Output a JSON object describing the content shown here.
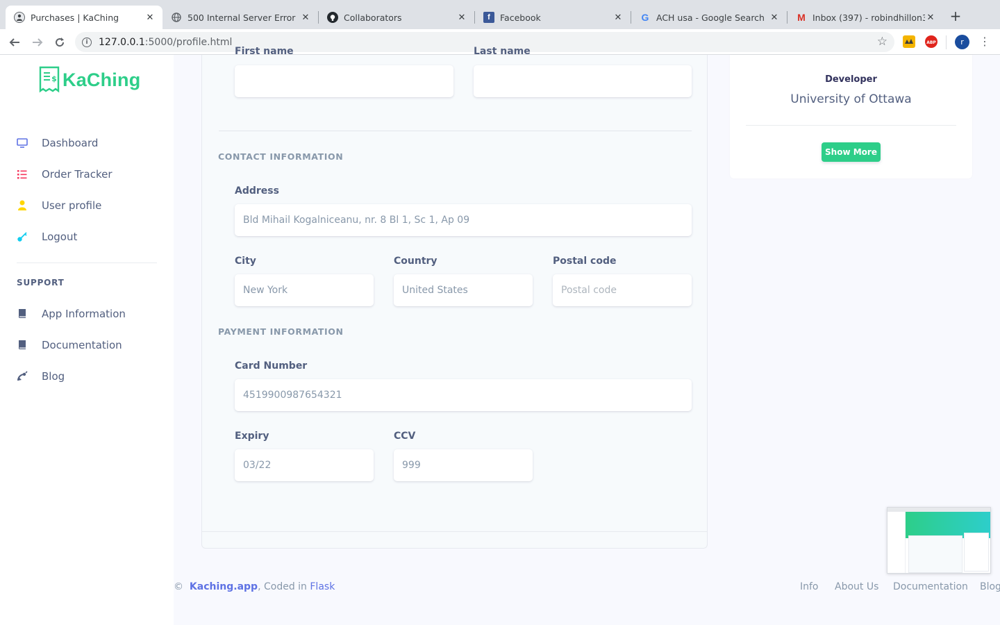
{
  "browser": {
    "tabs": [
      {
        "title": "Purchases | KaChing",
        "favicon": "kaching-avatar-icon",
        "active": true
      },
      {
        "title": "500 Internal Server Error",
        "favicon": "globe-icon",
        "active": false
      },
      {
        "title": "Collaborators",
        "favicon": "github-icon",
        "active": false
      },
      {
        "title": "Facebook",
        "favicon": "facebook-icon",
        "active": false
      },
      {
        "title": "ACH usa - Google Search",
        "favicon": "google-icon",
        "active": false
      },
      {
        "title": "Inbox (397) - robindhillon3111",
        "favicon": "gmail-icon",
        "active": false
      }
    ],
    "new_tab": "+",
    "url_host": "127.0.0.1",
    "url_path": ":5000/profile.html",
    "profile_initial": "r"
  },
  "sidebar": {
    "brand": "KaChing",
    "items": [
      {
        "label": "Dashboard",
        "icon": "monitor-icon",
        "color": "#5e72e4"
      },
      {
        "label": "Order Tracker",
        "icon": "bullet-list-icon",
        "color": "#f5365c"
      },
      {
        "label": "User profile",
        "icon": "single-user-icon",
        "color": "#ffd600"
      },
      {
        "label": "Logout",
        "icon": "key-icon",
        "color": "#11cdef"
      }
    ],
    "support_heading": "SUPPORT",
    "support_items": [
      {
        "label": "App Information",
        "icon": "book-icon"
      },
      {
        "label": "Documentation",
        "icon": "book-icon"
      },
      {
        "label": "Blog",
        "icon": "satellite-icon"
      }
    ]
  },
  "form": {
    "first_name_label": "First name",
    "last_name_label": "Last name",
    "first_name_value": "",
    "last_name_value": "",
    "contact_heading": "CONTACT INFORMATION",
    "address_label": "Address",
    "address_value": "Bld Mihail Kogalniceanu, nr. 8 Bl 1, Sc 1, Ap 09",
    "city_label": "City",
    "city_value": "New York",
    "country_label": "Country",
    "country_value": "United States",
    "postal_label": "Postal code",
    "postal_placeholder": "Postal code",
    "payment_heading": "PAYMENT INFORMATION",
    "card_label": "Card Number",
    "card_value": "4519900987654321",
    "expiry_label": "Expiry",
    "expiry_value": "03/22",
    "ccv_label": "CCV",
    "ccv_value": "999"
  },
  "profile_card": {
    "role": "Developer",
    "university": "University of Ottawa",
    "show_more": "Show More"
  },
  "footer": {
    "copyright": "©",
    "brand_link": "Kaching.app",
    "coded_in": ", Coded in ",
    "framework_link": "Flask",
    "links": [
      "Info",
      "About Us",
      "Documentation",
      "Blog"
    ]
  },
  "colors": {
    "brand_green": "#2dce89",
    "primary": "#5e72e4",
    "text_muted": "#8898aa"
  }
}
